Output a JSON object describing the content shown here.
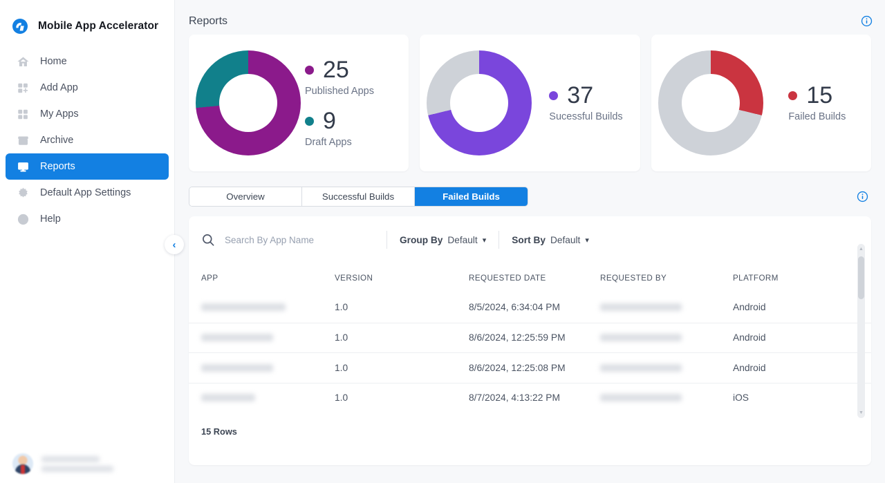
{
  "brand": {
    "name": "Mobile App Accelerator",
    "logo_icon": "accelerator-logo-icon"
  },
  "sidebar": {
    "items": [
      {
        "label": "Home",
        "icon": "home-icon",
        "active": false
      },
      {
        "label": "Add App",
        "icon": "add-app-grid-icon",
        "active": false
      },
      {
        "label": "My Apps",
        "icon": "grid-apps-icon",
        "active": false
      },
      {
        "label": "Archive",
        "icon": "archive-box-icon",
        "active": false
      },
      {
        "label": "Reports",
        "icon": "report-monitor-icon",
        "active": true
      },
      {
        "label": "Default App Settings",
        "icon": "gear-icon",
        "active": false
      },
      {
        "label": "Help",
        "icon": "help-circle-icon",
        "active": false
      }
    ],
    "collapse_icon": "chevron-left-icon",
    "user": {
      "name_redacted": true,
      "email_redacted": true,
      "avatar_icon": "user-avatar"
    }
  },
  "header": {
    "title": "Reports",
    "info_icon": "info-circle-icon"
  },
  "colors": {
    "accent_blue": "#1380e2",
    "purple": "#8b1a8b",
    "teal": "#11808b",
    "violet": "#7a46dc",
    "red": "#ca3440",
    "grey": "#ced2d8"
  },
  "cards": [
    {
      "donut_id": "apps-donut",
      "legend": [
        {
          "value": "25",
          "label": "Published Apps",
          "color": "#8b1a8b"
        },
        {
          "value": "9",
          "label": "Draft Apps",
          "color": "#11808b"
        }
      ]
    },
    {
      "donut_id": "successful-builds-donut",
      "legend": [
        {
          "value": "37",
          "label": "Sucessful Builds",
          "color": "#7a46dc"
        }
      ]
    },
    {
      "donut_id": "failed-builds-donut",
      "legend": [
        {
          "value": "15",
          "label": "Failed Builds",
          "color": "#ca3440"
        }
      ]
    }
  ],
  "tabs": [
    {
      "label": "Overview",
      "active": false
    },
    {
      "label": "Successful Builds",
      "active": false
    },
    {
      "label": "Failed Builds",
      "active": true
    }
  ],
  "panel_info_icon": "info-circle-icon",
  "toolbar": {
    "search_icon": "search-icon",
    "search_placeholder": "Search By App Name",
    "search_value": "",
    "group_by_label": "Group By",
    "group_by_value": "Default",
    "sort_by_label": "Sort By",
    "sort_by_value": "Default",
    "caret_icon": "chevron-down-icon"
  },
  "table": {
    "columns": [
      "APP",
      "VERSION",
      "REQUESTED DATE",
      "REQUESTED BY",
      "PLATFORM"
    ],
    "rows": [
      {
        "app": "",
        "app_redacted": true,
        "version": "1.0",
        "requested_date": "8/5/2024, 6:34:04 PM",
        "requested_by": "",
        "requested_by_redacted": true,
        "platform": "Android"
      },
      {
        "app": "",
        "app_redacted": true,
        "version": "1.0",
        "requested_date": "8/6/2024, 12:25:59 PM",
        "requested_by": "",
        "requested_by_redacted": true,
        "platform": "Android"
      },
      {
        "app": "",
        "app_redacted": true,
        "version": "1.0",
        "requested_date": "8/6/2024, 12:25:08 PM",
        "requested_by": "",
        "requested_by_redacted": true,
        "platform": "Android"
      },
      {
        "app": "",
        "app_redacted": true,
        "version": "1.0",
        "requested_date": "8/7/2024, 4:13:22 PM",
        "requested_by": "",
        "requested_by_redacted": true,
        "platform": "iOS"
      }
    ],
    "footer": "15 Rows",
    "scrollbar": {
      "visible": true
    }
  },
  "chart_data": [
    {
      "type": "pie",
      "title": "Apps",
      "labels": [
        "Published Apps",
        "Draft Apps"
      ],
      "values": [
        25,
        9
      ],
      "colors": [
        "#8b1a8b",
        "#11808b"
      ],
      "legend": "right",
      "donut": true
    },
    {
      "type": "pie",
      "title": "Sucessful Builds",
      "labels": [
        "Sucessful Builds",
        "Remaining"
      ],
      "values": [
        37,
        15
      ],
      "colors": [
        "#7a46dc",
        "#ced2d8"
      ],
      "legend": "right",
      "donut": true
    },
    {
      "type": "pie",
      "title": "Failed Builds",
      "labels": [
        "Failed Builds",
        "Remaining"
      ],
      "values": [
        15,
        37
      ],
      "colors": [
        "#ca3440",
        "#ced2d8"
      ],
      "legend": "right",
      "donut": true
    }
  ]
}
